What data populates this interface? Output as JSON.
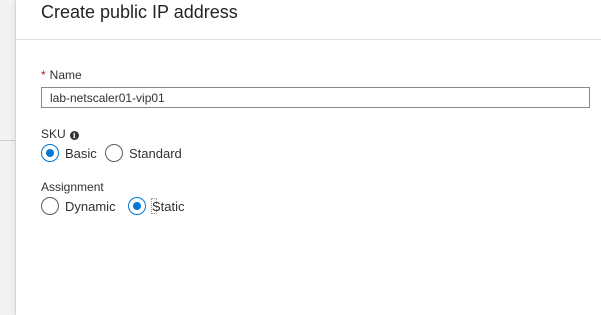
{
  "panel": {
    "title": "Create public IP address"
  },
  "name_field": {
    "required_marker": "*",
    "label": "Name",
    "value": "lab-netscaler01-vip01"
  },
  "sku": {
    "label": "SKU",
    "info_icon": "info-icon",
    "options": [
      {
        "label": "Basic",
        "selected": true
      },
      {
        "label": "Standard",
        "selected": false
      }
    ]
  },
  "assignment": {
    "label": "Assignment",
    "options": [
      {
        "label": "Dynamic",
        "selected": false
      },
      {
        "label": "Static",
        "selected": true
      }
    ]
  },
  "colors": {
    "accent": "#0078d4",
    "required": "#a4262c"
  }
}
